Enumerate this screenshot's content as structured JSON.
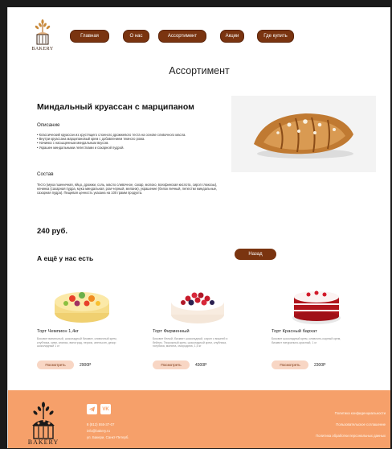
{
  "nav": {
    "items": [
      {
        "label": "Главная"
      },
      {
        "label": "О нас"
      },
      {
        "label": "Ассортимент"
      },
      {
        "label": "Акции"
      },
      {
        "label": "Где купить"
      }
    ]
  },
  "logo": {
    "text": "BAKERY"
  },
  "page": {
    "title": "Ассортимент"
  },
  "product": {
    "name": "Миндальный круассан с марципаном",
    "description_label": "Описание",
    "description_lines": [
      "• Классический круассан из хрустящего слоеного дрожжевого теста на основе сливочного масла.",
      "• Внутри круассана марципановый крем с добавлением темного рома.",
      "• Начинка с насыщенным миндальным вкусом.",
      "• Украшен миндальными лепестками и сахарной пудрой."
    ],
    "composition_label": "Состав",
    "composition_text": "Тесто (мука пшеничная, яйцо, дрожжи, соль, масло сливочное, сахар, молоко, всехфинская кислота, сироп глюкозы), начинка (сахарная пудра, мука миндальная, ром черный, меланж), украшение (белок яичный, лепестки миндальные, сахарная пудра). Пищевая ценность указана на 100 грамм продукта.",
    "price": "240 руб."
  },
  "more": {
    "title": "А ещё у нас есть",
    "back_label": "Назад",
    "cards": [
      {
        "name": "Торт Чемпион 1,4кг",
        "desc": "Бисквит ванильный, шоколадный бисквит, сливочный крем, клубника, киви, ананас, виноград, персик, апельсин, декор шоколадный 1 кг",
        "view": "Посмотреть",
        "price": "2900Р"
      },
      {
        "name": "Торт Фирменный",
        "desc": "Бисквит белый, бисквит шоколадный, сироп с вишней и бейлиз. Творожный крем, шоколадный крем, клубника, голубика, малина, смородина, 1,5 кг",
        "view": "Посмотреть",
        "price": "4300Р"
      },
      {
        "name": "Торт Красный бархат",
        "desc": "Бисквит шоколадный крем, сливочно-сырный крем, бисквит натурально-красный, 1 кг",
        "view": "Посмотреть",
        "price": "2300Р"
      }
    ]
  },
  "footer": {
    "phone": "8 (812) 555-37-07",
    "email": "info@bakery.ru",
    "address": "ул. Бакери, Санкт-Петерб.",
    "links": [
      "Политика конфиденциальности",
      "Пользовательское соглашение",
      "Политика обработки персональных данных"
    ]
  },
  "colors": {
    "brand": "#7a3410",
    "footer": "#f6a06a",
    "view_btn": "#f8d6c4"
  }
}
